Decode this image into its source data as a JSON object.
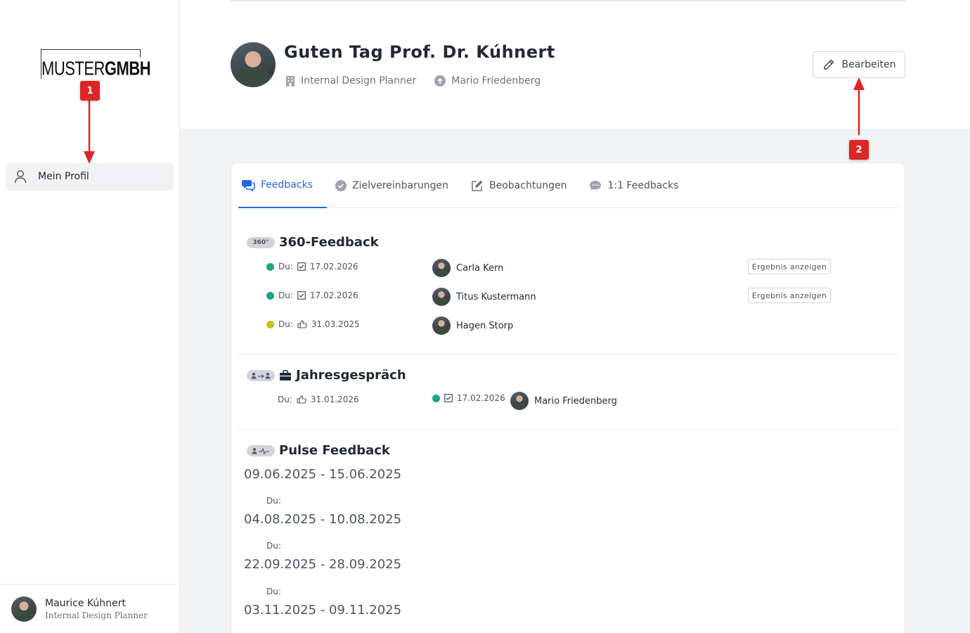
{
  "sidebar": {
    "logo": {
      "light": "MUSTER",
      "bold": "GMBH"
    },
    "nav_item": "Mein Profil",
    "user": {
      "name": "Maurice Kúhnert",
      "role": "Internal Design Planner"
    }
  },
  "header": {
    "greeting": "Guten Tag Prof. Dr. Kúhnert",
    "position": "Internal Design Planner",
    "manager": "Mario Friedenberg",
    "edit_label": "Bearbeiten"
  },
  "annotations": {
    "badge1": "1",
    "badge2": "2"
  },
  "tabs": [
    {
      "label": "Feedbacks",
      "active": true
    },
    {
      "label": "Zielvereinbarungen",
      "active": false
    },
    {
      "label": "Beobachtungen",
      "active": false
    },
    {
      "label": "1:1 Feedbacks",
      "active": false
    }
  ],
  "feedback360": {
    "title": "360-Feedback",
    "icon_label": "360°",
    "rows": [
      {
        "status_color": "#1aa384",
        "du": "Du:",
        "date": "17.02.2026",
        "person": "Carla Kern",
        "result_label": "Ergebnis anzeigen"
      },
      {
        "status_color": "#1aa384",
        "du": "Du:",
        "date": "17.02.2026",
        "person": "Titus Kustermann",
        "result_label": "Ergebnis anzeigen"
      },
      {
        "status_color": "#c9c21a",
        "du": "Du:",
        "date": "31.03.2025",
        "person": "Hagen Storp"
      }
    ]
  },
  "jahresgespraech": {
    "title": "Jahresgespräch",
    "du": "Du:",
    "due_date": "31.01.2026",
    "done_date": "17.02.2026",
    "person": "Mario Friedenberg"
  },
  "pulse": {
    "title": "Pulse Feedback",
    "periods": [
      {
        "range": "09.06.2025 - 15.06.2025",
        "du": "Du:"
      },
      {
        "range": "04.08.2025 - 10.08.2025",
        "du": "Du:"
      },
      {
        "range": "22.09.2025 - 28.09.2025",
        "du": "Du:"
      },
      {
        "range": "03.11.2025 - 09.11.2025"
      }
    ]
  },
  "colors": {
    "accent": "#2563eb",
    "annotation": "#dc2626"
  }
}
